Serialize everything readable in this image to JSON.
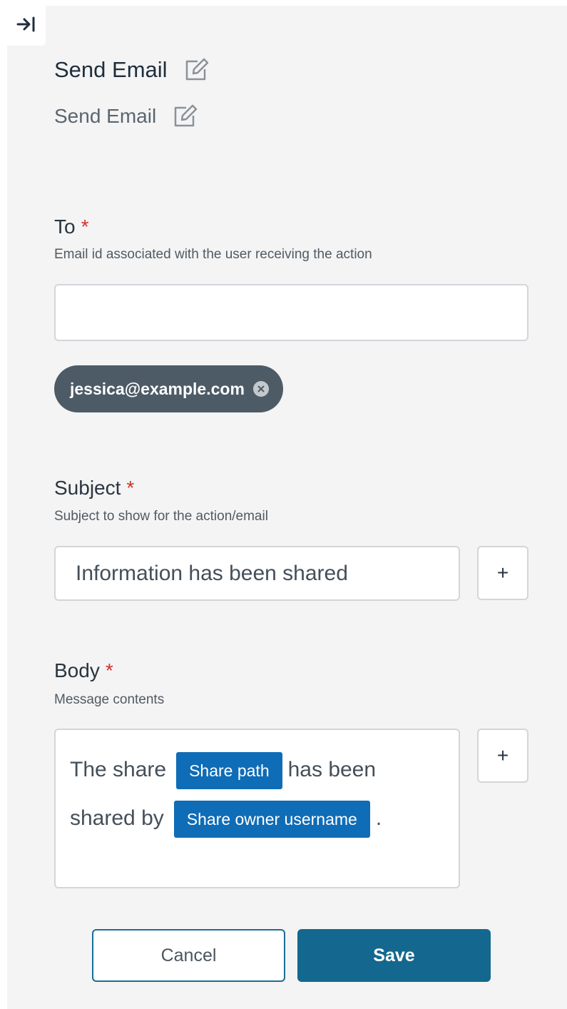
{
  "header": {
    "title": "Send Email",
    "subtitle": "Send Email",
    "collapse_icon": "collapse-right-icon",
    "edit_icon": "pencil-square-icon"
  },
  "to": {
    "label": "To",
    "required_mark": "*",
    "help": "Email id associated with the user receiving the action",
    "value": "",
    "chips": [
      "jessica@example.com"
    ]
  },
  "subject": {
    "label": "Subject",
    "required_mark": "*",
    "help": "Subject to show for the action/email",
    "value": "Information has been shared",
    "add_label": "+"
  },
  "body": {
    "label": "Body",
    "required_mark": "*",
    "help": "Message contents",
    "add_label": "+",
    "segments": {
      "text1": "The share",
      "tag1": "Share path",
      "text2": "has been shared by",
      "tag2": "Share owner username",
      "text3": "."
    }
  },
  "actions": {
    "cancel": "Cancel",
    "save": "Save"
  },
  "colors": {
    "required": "#d0312d",
    "tag": "#0f6cb6",
    "primary": "#14688f",
    "chip": "#4d5b66"
  }
}
